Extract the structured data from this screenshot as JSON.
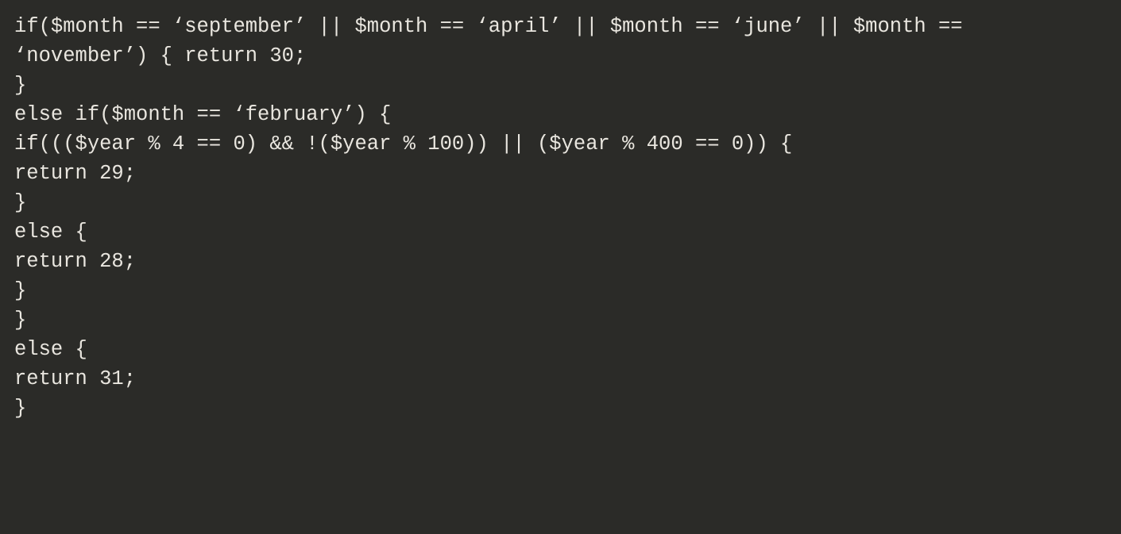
{
  "code": {
    "lines": [
      "if($month == ‘september’ || $month == ‘april’ || $month == ‘june’ || $month == ‘november’) { return 30;",
      "}",
      "else if($month == ‘february’) {",
      "if((($year % 4 == 0) && !($year % 100)) || ($year % 400 == 0)) {",
      "return 29;",
      "}",
      "else {",
      "return 28;",
      "}",
      "}",
      "else {",
      "return 31;",
      "}"
    ]
  },
  "colors": {
    "background": "#2b2b28",
    "text": "#e9e6df"
  }
}
